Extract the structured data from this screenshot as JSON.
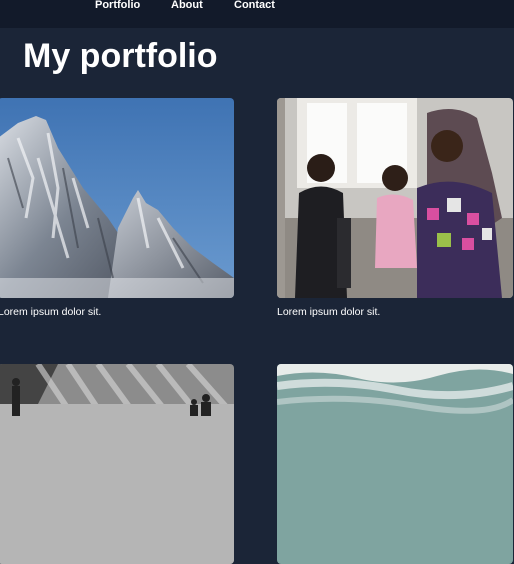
{
  "nav": {
    "items": [
      "Portfolio",
      "About",
      "Contact"
    ]
  },
  "page": {
    "title": "My portfolio"
  },
  "cards": [
    {
      "caption": "Lorem ipsum dolor sit.",
      "image": "mountain-peaks-photo"
    },
    {
      "caption": "Lorem ipsum dolor sit.",
      "image": "people-seated-in-room-photo"
    },
    {
      "caption": "",
      "image": "city-street-photo"
    },
    {
      "caption": "",
      "image": "ocean-waves-photo"
    }
  ],
  "colors": {
    "background": "#1b2537",
    "topbar": "#121a2a",
    "text": "#ffffff"
  }
}
